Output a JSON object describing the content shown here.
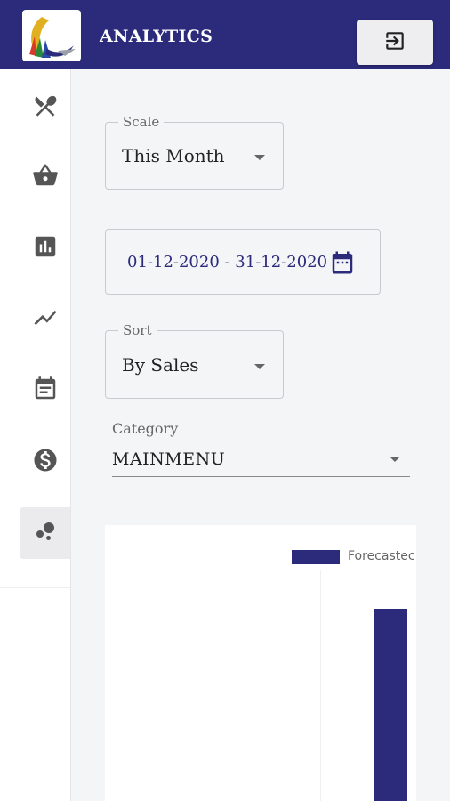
{
  "header": {
    "title": "ANALYTICS",
    "logo_icon": "app-logo-icon",
    "logout_icon": "exit-to-app-icon"
  },
  "sidebar": {
    "items": [
      {
        "icon": "restaurant-icon"
      },
      {
        "icon": "basket-icon"
      },
      {
        "icon": "bar-chart-icon"
      },
      {
        "icon": "trending-icon"
      },
      {
        "icon": "calendar-note-icon"
      },
      {
        "icon": "dollar-icon"
      },
      {
        "icon": "bubble-chart-icon",
        "active": true
      }
    ]
  },
  "filters": {
    "scale": {
      "label": "Scale",
      "value": "This Month"
    },
    "date_range": {
      "value": "01-12-2020 - 31-12-2020"
    },
    "sort": {
      "label": "Sort",
      "value": "By Sales"
    },
    "category": {
      "label": "Category",
      "value": "MAINMENU"
    }
  },
  "chart_data": {
    "type": "bar",
    "series": [
      {
        "name": "Forecastec",
        "values": [
          1
        ]
      }
    ],
    "colors": [
      "#2b2a7b"
    ]
  },
  "colors": {
    "primary": "#2b2a7b",
    "background": "#f4f5f7"
  }
}
